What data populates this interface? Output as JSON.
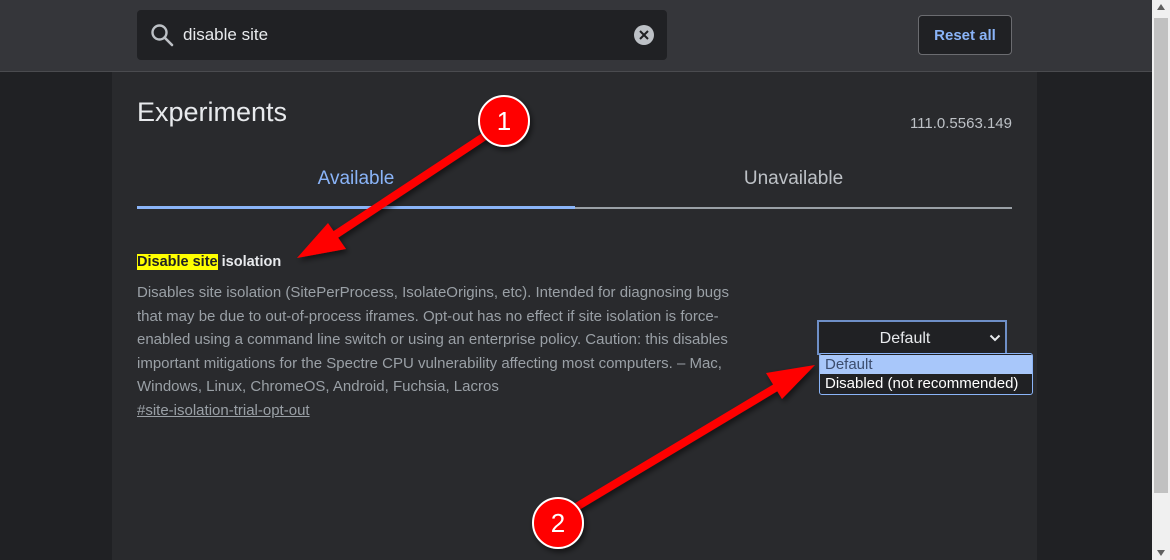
{
  "search": {
    "value": "disable site"
  },
  "header": {
    "reset_label": "Reset all"
  },
  "page": {
    "title": "Experiments",
    "version": "111.0.5563.149"
  },
  "tabs": [
    {
      "label": "Available",
      "active": true
    },
    {
      "label": "Unavailable",
      "active": false
    }
  ],
  "experiment": {
    "name_highlight": "Disable site",
    "name_rest": " isolation",
    "description_lines": [
      "Disables site isolation (SitePerProcess, IsolateOrigins, etc). Intended for diagnosing bugs",
      "that may be due to out-of-process iframes. Opt-out has no effect if site isolation is force-",
      "enabled using a command line switch or using an enterprise policy. Caution: this disables",
      "important mitigations for the Spectre CPU vulnerability affecting most computers. – Mac,",
      "Windows, Linux, ChromeOS, Android, Fuchsia, Lacros"
    ],
    "link": "#site-isolation-trial-opt-out",
    "selected": "Default",
    "options": [
      "Default",
      "Disabled (not recommended)"
    ]
  },
  "annotations": {
    "badge_1": "1",
    "badge_2": "2"
  },
  "colors": {
    "accent": "#8ab4f8",
    "highlight": "#ffff00",
    "annotation": "#ff0000"
  }
}
